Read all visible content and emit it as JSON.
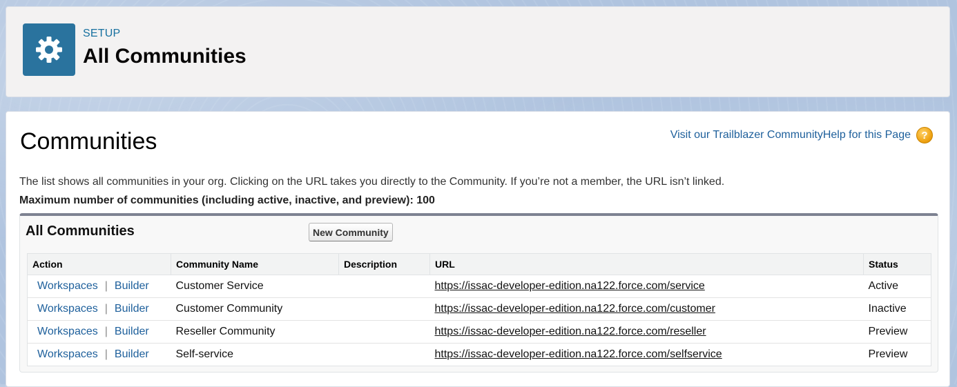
{
  "header": {
    "setup_label": "SETUP",
    "title": "All Communities",
    "icon": "gear-icon"
  },
  "main": {
    "title": "Communities",
    "links": {
      "trailblazer": "Visit our Trailblazer Community",
      "help": "Help for this Page",
      "help_icon_glyph": "?"
    },
    "description": "The list shows all communities in your org. Clicking on the URL takes you directly to the Community. If you’re not a member, the URL isn’t linked.",
    "max_line": "Maximum number of communities (including active, inactive, and preview): 100"
  },
  "block": {
    "title": "All Communities",
    "new_button": "New Community",
    "columns": [
      "Action",
      "Community Name",
      "Description",
      "URL",
      "Status"
    ],
    "action_labels": {
      "workspaces": "Workspaces",
      "separator": "|",
      "builder": "Builder"
    },
    "rows": [
      {
        "name": "Customer Service",
        "description": "",
        "url": "https://issac-developer-edition.na122.force.com/service",
        "status": "Active"
      },
      {
        "name": "Customer Community",
        "description": "",
        "url": "https://issac-developer-edition.na122.force.com/customer",
        "status": "Inactive"
      },
      {
        "name": "Reseller Community",
        "description": "",
        "url": "https://issac-developer-edition.na122.force.com/reseller",
        "status": "Preview"
      },
      {
        "name": "Self-service",
        "description": "",
        "url": "https://issac-developer-edition.na122.force.com/selfservice",
        "status": "Preview"
      }
    ]
  },
  "colors": {
    "accent": "#2a739e",
    "link": "#1d5f9b",
    "setup_label": "#16709f",
    "block_top_border": "#7d8291"
  }
}
